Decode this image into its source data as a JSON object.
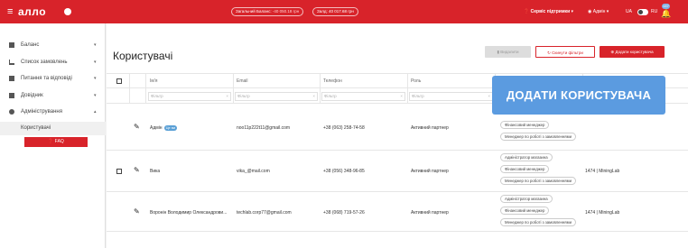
{
  "topbar": {
    "logo": "алло",
    "balance_label": "Загальний Баланс:",
    "balance_value": "-40 050.18 грн",
    "deposit": "Залд: 40 017.68 грн",
    "service": "Сервіс підтримки",
    "user": "Адмін",
    "lang_ua": "UA",
    "lang_ru": "RU",
    "notif_count": "147"
  },
  "sidebar": {
    "items": [
      {
        "label": "Баланс",
        "icon": "document-icon",
        "chevron": "▾"
      },
      {
        "label": "Список замовлень",
        "icon": "cart-icon",
        "chevron": "▾"
      },
      {
        "label": "Питання та відповіді",
        "icon": "chat-icon",
        "chevron": "▾"
      },
      {
        "label": "Довідник",
        "icon": "book-icon",
        "chevron": "▾"
      },
      {
        "label": "Адміністрування",
        "icon": "gear-icon",
        "chevron": "▴"
      }
    ],
    "subitem": "Користувачі",
    "faq": "FAQ"
  },
  "main": {
    "title": "Користувачі",
    "delete_label": "Видалити",
    "reset_label": "Скинути фільтри",
    "add_label": "Додати користувача"
  },
  "table": {
    "headers": [
      "Ім'я",
      "Email",
      "Телефон",
      "Роль",
      ""
    ],
    "filter_placeholder": "Фільтр",
    "rows": [
      {
        "name": "Адмін",
        "tag": "Це ви",
        "email": "noo11p222t11@gmail.com",
        "phone": "+38 (063) 258-74-58",
        "role": "Активний партнер",
        "chips": [
          "Фінансовий менеджер",
          "Менеджер по роботі з замовленнями"
        ],
        "company": ""
      },
      {
        "name": "Вика",
        "tag": "",
        "email": "vika_@mail.com",
        "phone": "+38 (056) 348-96-85",
        "role": "Активний партнер",
        "chips": [
          "Адміністратор магазина",
          "Фінансовий менеджер",
          "Менеджер по роботі з замовленнями"
        ],
        "company": "1474 | MiningLab"
      },
      {
        "name": "Воронін Володимир Олександрови...",
        "tag": "",
        "email": "techlab.corp77@gmail.com",
        "phone": "+38 (068) 719-57-26",
        "role": "Активний партнер",
        "chips": [
          "Адміністратор магазина",
          "Фінансовий менеджер",
          "Менеджер по роботі з замовленнями"
        ],
        "company": "1474 | MiningLab"
      }
    ]
  },
  "tooltip": "ДОДАТИ КОРИСТУВАЧА",
  "colors": {
    "brand": "#d8232a",
    "accent": "#5b9be0"
  }
}
